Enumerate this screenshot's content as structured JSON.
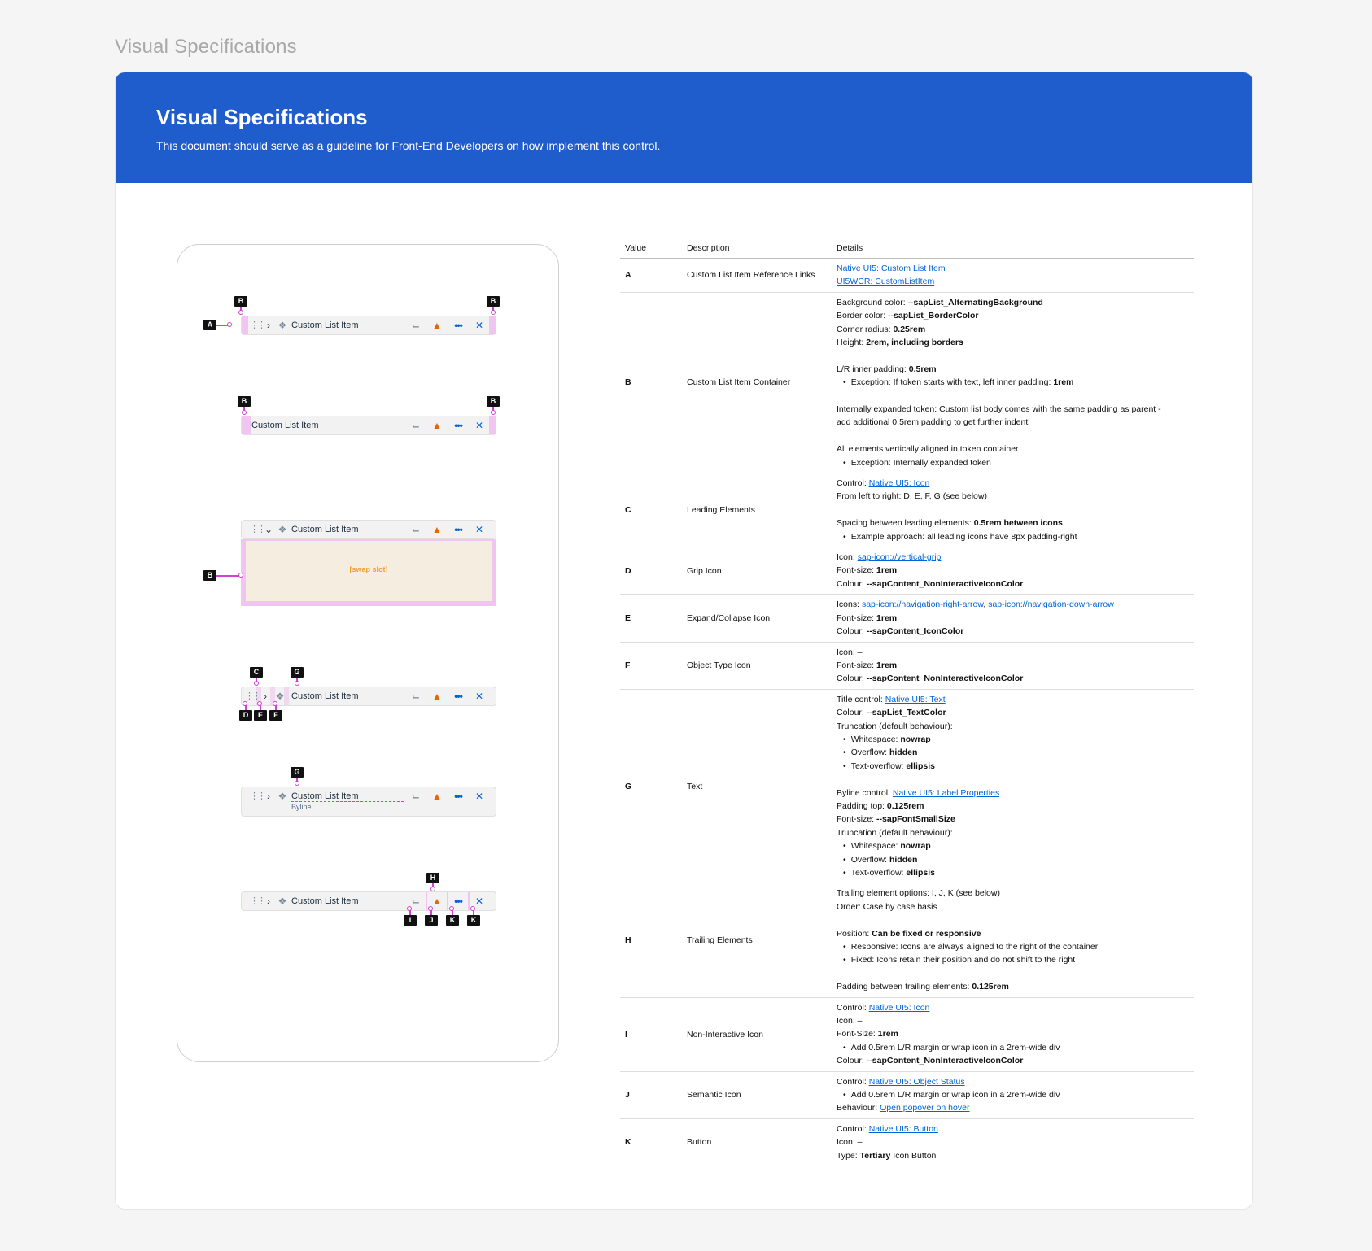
{
  "page_title": "Visual Specifications",
  "banner": {
    "title": "Visual Specifications",
    "subtitle": "This document should serve as a guideline for Front-End Developers on how implement this control."
  },
  "preview": {
    "item_label": "Custom List Item",
    "byline": "Byline",
    "swap_slot": "[swap slot]",
    "tags": {
      "A": "A",
      "B": "B",
      "C": "C",
      "D": "D",
      "E": "E",
      "F": "F",
      "G": "G",
      "H": "H",
      "I": "I",
      "J": "J",
      "K": "K"
    },
    "icons": [
      "grip-icon",
      "chevron-right-icon",
      "chevron-down-icon",
      "object-type-icon",
      "hierarchy-icon",
      "warning-icon",
      "overflow-icon",
      "close-icon"
    ]
  },
  "table": {
    "headers": {
      "value": "Value",
      "description": "Description",
      "details": "Details"
    },
    "rows": {
      "A": {
        "value": "A",
        "description": "Custom List Item Reference Links",
        "link1": "Native UI5: Custom List Item",
        "link2": "UI5WCR: CustomListItem"
      },
      "B": {
        "value": "B",
        "description": "Custom List Item Container",
        "bg_label": "Background color: ",
        "bg_val": "--sapList_AlternatingBackground",
        "border_label": "Border color: ",
        "border_val": "--sapList_BorderColor",
        "radius_label": "Corner radius: ",
        "radius_val": "0.25rem",
        "height_label": "Height: ",
        "height_val": "2rem, including borders",
        "pad_label": "L/R inner padding: ",
        "pad_val": "0.5rem",
        "pad_exc": "Exception: If token starts with text, left inner padding: ",
        "pad_exc_val": "1rem",
        "expanded1": "Internally expanded token: Custom list body comes with the same padding as parent -",
        "expanded2": "add additional 0.5rem padding to get further indent",
        "align": "All elements vertically aligned in token container",
        "align_exc": "Exception: Internally expanded token"
      },
      "C": {
        "value": "C",
        "description": "Leading Elements",
        "control_label": "Control: ",
        "control_link": "Native UI5: Icon",
        "order": "From left to right: D, E, F, G (see below)",
        "spacing_label": "Spacing between leading elements: ",
        "spacing_val": "0.5rem between icons",
        "example": "Example approach: all leading icons have 8px padding-right"
      },
      "D": {
        "value": "D",
        "description": "Grip Icon",
        "icon_label": "Icon: ",
        "icon_link": "sap-icon://vertical-grip",
        "fs_label": "Font-size: ",
        "fs_val": "1rem",
        "col_label": "Colour: ",
        "col_val": "--sapContent_NonInteractiveIconColor"
      },
      "E": {
        "value": "E",
        "description": "Expand/Collapse Icon",
        "icon_label": "Icons: ",
        "icon_link1": "sap-icon://navigation-right-arrow",
        "sep": ", ",
        "icon_link2": "sap-icon://navigation-down-arrow",
        "fs_label": "Font-size: ",
        "fs_val": "1rem",
        "col_label": "Colour: ",
        "col_val": "--sapContent_IconColor"
      },
      "F": {
        "value": "F",
        "description": "Object Type Icon",
        "icon": "Icon: –",
        "fs_label": "Font-size: ",
        "fs_val": "1rem",
        "col_label": "Colour: ",
        "col_val": "--sapContent_NonInteractiveIconColor"
      },
      "G": {
        "value": "G",
        "description": "Text",
        "title_label": "Title control: ",
        "title_link": "Native UI5: Text",
        "col_label": "Colour: ",
        "col_val": "--sapList_TextColor",
        "trunc": "Truncation (default behaviour):",
        "ws_label": "Whitespace: ",
        "ws_val": "nowrap",
        "ov_label": "Overflow: ",
        "ov_val": "hidden",
        "to_label": "Text-overflow: ",
        "to_val": "ellipsis",
        "byline_label": "Byline control: ",
        "byline_link": "Native UI5: Label Properties",
        "pt_label": "Padding top: ",
        "pt_val": "0.125rem",
        "fs_label": "Font-size: ",
        "fs_val": "--sapFontSmallSize"
      },
      "H": {
        "value": "H",
        "description": "Trailing Elements",
        "options": "Trailing element options: I, J, K (see below)",
        "order": "Order: Case by case basis",
        "pos_label": "Position: ",
        "pos_val": "Can be fixed or responsive",
        "responsive": "Responsive: Icons are always aligned to the right of the container",
        "fixed": "Fixed: Icons retain their position and do not shift to the right",
        "padding_label": "Padding between trailing elements: ",
        "padding_val": "0.125rem"
      },
      "I": {
        "value": "I",
        "description": "Non-Interactive Icon",
        "control_label": "Control: ",
        "control_link": "Native UI5: Icon",
        "icon": "Icon: –",
        "fs_label": "Font-Size: ",
        "fs_val": "1rem",
        "margin": "Add 0.5rem L/R margin or wrap icon in a 2rem-wide div",
        "col_label": "Colour: ",
        "col_val": "--sapContent_NonInteractiveIconColor"
      },
      "J": {
        "value": "J",
        "description": "Semantic Icon",
        "control_label": "Control: ",
        "control_link": "Native UI5: Object Status",
        "margin": "Add 0.5rem L/R margin or wrap icon in a 2rem-wide div",
        "beh_label": "Behaviour: ",
        "beh_link": "Open popover on hover"
      },
      "K": {
        "value": "K",
        "description": "Button",
        "control_label": "Control: ",
        "control_link": "Native UI5: Button",
        "icon": "Icon: –",
        "type_label": "Type: ",
        "type_val": "Tertiary",
        "type_rest": " Icon Button"
      }
    }
  }
}
